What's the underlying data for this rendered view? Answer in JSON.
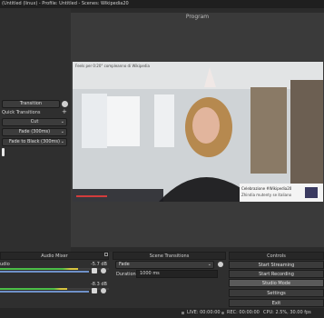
{
  "window": {
    "title": "(Untitled (linux) - Profile: Untitled - Scenes: Wikipedia20"
  },
  "program": {
    "label": "Program"
  },
  "video": {
    "overlay_title": "Feels per 0:20° compleanno di Wikipedia",
    "lower_third_name": "Celebrazione #Wikipedia20",
    "lower_third_sub": "Zhindia mutenty se italiano"
  },
  "left_panel": {
    "transition_button": "Transition",
    "quick_transitions_label": "Quick Transitions",
    "items": [
      "Cut",
      "Fade (300ms)",
      "Fade to Black (300ms)"
    ]
  },
  "audio_mixer": {
    "title": "Audio Mixer",
    "channels": [
      {
        "name": "udio",
        "db": "-5.7 dB",
        "level": 0.72
      },
      {
        "name": "",
        "db": "-8.3 dB",
        "level": 0.62
      }
    ]
  },
  "scene_transitions": {
    "title": "Scene Transitions",
    "selected": "Fade",
    "duration_label": "Duration",
    "duration_value": "1000 ms"
  },
  "controls": {
    "title": "Controls",
    "buttons": [
      "Start Streaming",
      "Start Recording",
      "Studio Mode",
      "Settings",
      "Exit"
    ]
  },
  "status": {
    "live": "LIVE: 00:00:00",
    "rec": "REC: 00:00:00",
    "cpu": "CPU: 2.5%, 30.00 fps"
  },
  "colors": {
    "accent_green": "#5fcf50",
    "accent_red": "#d23c3c",
    "active_button": "#5a5a5a"
  }
}
